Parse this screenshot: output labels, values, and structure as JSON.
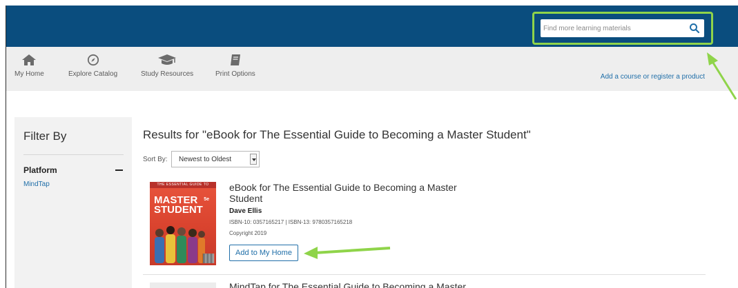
{
  "search": {
    "placeholder": "Find more learning materials",
    "icon": "search-icon"
  },
  "nav": {
    "items": [
      {
        "label": "My Home",
        "icon": "home-icon"
      },
      {
        "label": "Explore Catalog",
        "icon": "compass-icon"
      },
      {
        "label": "Study Resources",
        "icon": "graduation-cap-icon"
      },
      {
        "label": "Print Options",
        "icon": "book-icon"
      }
    ],
    "right_link": "Add a course or register a product"
  },
  "filter": {
    "title": "Filter By",
    "section": "Platform",
    "option": "MindTap"
  },
  "results": {
    "title": "Results for \"eBook for The Essential Guide to Becoming a Master Student\"",
    "sort_label": "Sort By:",
    "sort_value": "Newest to Oldest",
    "items": [
      {
        "title": "eBook for The Essential Guide to Becoming a Master Student",
        "author": "Dave Ellis",
        "isbn": "ISBN-10: 0357165217 | ISBN-13: 9780357165218",
        "copyright": "Copyright 2019",
        "button": "Add to My Home",
        "cover": {
          "band": "THE ESSENTIAL GUIDE TO",
          "line1": "MASTER",
          "line2": "STUDENT",
          "edition": "5e"
        }
      },
      {
        "title": "MindTap for The Essential Guide to Becoming a Master"
      }
    ]
  },
  "colors": {
    "header": "#0a4d7e",
    "highlight": "#8fd44a",
    "link": "#1f6ea8"
  }
}
